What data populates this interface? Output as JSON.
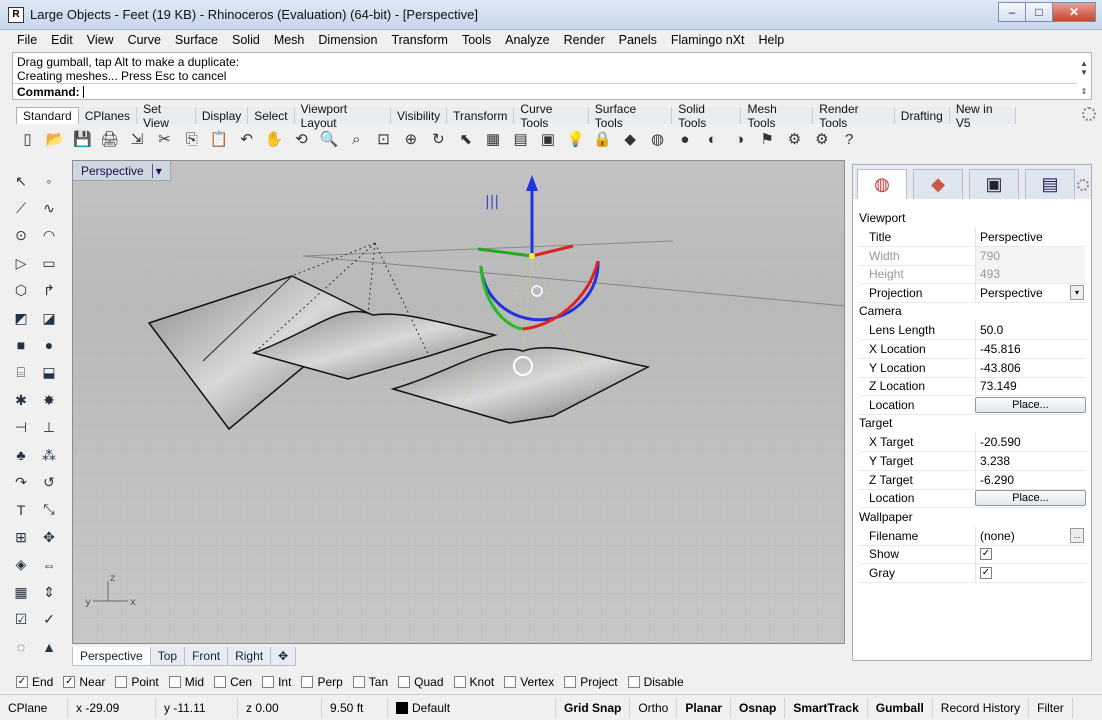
{
  "window": {
    "title": "Large Objects - Feet (19 KB) - Rhinoceros (Evaluation) (64-bit) - [Perspective]",
    "icon_glyph": "R",
    "min": "–",
    "max": "□",
    "close": "✕"
  },
  "menu": [
    "File",
    "Edit",
    "View",
    "Curve",
    "Surface",
    "Solid",
    "Mesh",
    "Dimension",
    "Transform",
    "Tools",
    "Analyze",
    "Render",
    "Panels",
    "Flamingo nXt",
    "Help"
  ],
  "command": {
    "history1": "Drag gumball, tap Alt to make a duplicate:",
    "history2": "Creating meshes... Press Esc to cancel",
    "label": "Command:",
    "value": ""
  },
  "toolbar_tabs": [
    "Standard",
    "CPlanes",
    "Set View",
    "Display",
    "Select",
    "Viewport Layout",
    "Visibility",
    "Transform",
    "Curve Tools",
    "Surface Tools",
    "Solid Tools",
    "Mesh Tools",
    "Render Tools",
    "Drafting",
    "New in V5"
  ],
  "toolbar_icons": [
    "new-icon",
    "open-icon",
    "save-icon",
    "print-icon",
    "import-icon",
    "cut-icon",
    "copy-icon",
    "paste-icon",
    "undo-icon",
    "pan-icon",
    "rotate-view-icon",
    "zoom-icon",
    "zoom-window-icon",
    "zoom-extents-icon",
    "zoom-selected-icon",
    "rotate-icon",
    "select-icon",
    "grid-icon",
    "layer-icon",
    "properties-icon",
    "light-icon",
    "lock-icon",
    "material-icon",
    "color-wheel-icon",
    "render-sphere-icon",
    "render-preview-icon",
    "shade-icon",
    "flag-icon",
    "options-icon",
    "options2-icon",
    "help-icon"
  ],
  "toolbar_glyphs": [
    "▯",
    "📂",
    "💾",
    "🖨",
    "⇲",
    "✂",
    "⎘",
    "📋",
    "↶",
    "✋",
    "⟲",
    "🔍",
    "⌕",
    "⊡",
    "⊕",
    "↻",
    "⬉",
    "▦",
    "▤",
    "▣",
    "💡",
    "🔒",
    "◆",
    "◍",
    "●",
    "◐",
    "◑",
    "⚑",
    "⚙",
    "⚙",
    "?"
  ],
  "left_icons": [
    {
      "name": "select-arrow-icon",
      "glyph": "↖"
    },
    {
      "name": "point-icon",
      "glyph": "◦"
    },
    {
      "name": "polyline-icon",
      "glyph": "⟋"
    },
    {
      "name": "curve-icon",
      "glyph": "∿"
    },
    {
      "name": "circle-icon",
      "glyph": "⊙"
    },
    {
      "name": "arc-icon",
      "glyph": "◠"
    },
    {
      "name": "triangle-icon",
      "glyph": "▷"
    },
    {
      "name": "rectangle-icon",
      "glyph": "▭"
    },
    {
      "name": "polygon-icon",
      "glyph": "⬡"
    },
    {
      "name": "fillet-icon",
      "glyph": "↱"
    },
    {
      "name": "surface-icon",
      "glyph": "◩"
    },
    {
      "name": "loft-icon",
      "glyph": "◪"
    },
    {
      "name": "box-icon",
      "glyph": "■"
    },
    {
      "name": "sphere-icon",
      "glyph": "●"
    },
    {
      "name": "cylinder-icon",
      "glyph": "⌸"
    },
    {
      "name": "extrude-icon",
      "glyph": "⬓"
    },
    {
      "name": "boolean-icon",
      "glyph": "✱"
    },
    {
      "name": "explode-icon",
      "glyph": "✸"
    },
    {
      "name": "trim-icon",
      "glyph": "⊣"
    },
    {
      "name": "split-icon",
      "glyph": "⊥"
    },
    {
      "name": "group-icon",
      "glyph": "♣"
    },
    {
      "name": "array-icon",
      "glyph": "⁂"
    },
    {
      "name": "move-icon",
      "glyph": "↷"
    },
    {
      "name": "copy-tool-icon",
      "glyph": "↺"
    },
    {
      "name": "text-icon",
      "glyph": "T"
    },
    {
      "name": "scale-icon",
      "glyph": "⤡"
    },
    {
      "name": "gumball-icon",
      "glyph": "⊞"
    },
    {
      "name": "drag-icon",
      "glyph": "✥"
    },
    {
      "name": "analyze-icon",
      "glyph": "◈"
    },
    {
      "name": "dimension-icon",
      "glyph": "⇔"
    },
    {
      "name": "grid-array-icon",
      "glyph": "▦"
    },
    {
      "name": "nudge-icon",
      "glyph": "⇕"
    },
    {
      "name": "check-icon",
      "glyph": "☑"
    },
    {
      "name": "checkmark-icon",
      "glyph": "✓"
    },
    {
      "name": "hide-icon",
      "glyph": "◌"
    },
    {
      "name": "warning-icon",
      "glyph": "▲"
    }
  ],
  "viewport": {
    "title": "Perspective",
    "dropdown": "▾",
    "axis_x": "x",
    "axis_y": "y",
    "axis_z": "z",
    "gumball_glyph": "|||"
  },
  "viewport_tabs": [
    "Perspective",
    "Top",
    "Front",
    "Right",
    "✥"
  ],
  "osnaps": [
    {
      "label": "End",
      "checked": true
    },
    {
      "label": "Near",
      "checked": true
    },
    {
      "label": "Point",
      "checked": false
    },
    {
      "label": "Mid",
      "checked": false
    },
    {
      "label": "Cen",
      "checked": false
    },
    {
      "label": "Int",
      "checked": false
    },
    {
      "label": "Perp",
      "checked": false
    },
    {
      "label": "Tan",
      "checked": false
    },
    {
      "label": "Quad",
      "checked": false
    },
    {
      "label": "Knot",
      "checked": false
    },
    {
      "label": "Vertex",
      "checked": false
    },
    {
      "label": "Project",
      "checked": false
    },
    {
      "label": "Disable",
      "checked": false
    }
  ],
  "status": {
    "cplane": "CPlane",
    "x": "x -29.09",
    "y": "y -11.11",
    "z": "z 0.00",
    "units": "9.50 ft",
    "layer": "Default",
    "toggles": [
      "Grid Snap",
      "Ortho",
      "Planar",
      "Osnap",
      "SmartTrack",
      "Gumball",
      "Record History",
      "Filter"
    ],
    "bold": [
      true,
      false,
      true,
      true,
      true,
      true,
      false,
      false
    ]
  },
  "panel": {
    "tab_glyphs": [
      "◍",
      "◆",
      "▣",
      "▤"
    ],
    "viewport_section": "Viewport",
    "rows1": [
      [
        "Title",
        "Perspective"
      ],
      [
        "Width",
        "790"
      ],
      [
        "Height",
        "493"
      ],
      [
        "Projection",
        "Perspective"
      ]
    ],
    "camera_section": "Camera",
    "rows2": [
      [
        "Lens Length",
        "50.0"
      ],
      [
        "X Location",
        "-45.816"
      ],
      [
        "Y Location",
        "-43.806"
      ],
      [
        "Z Location",
        "73.149"
      ],
      [
        "Location",
        "Place..."
      ]
    ],
    "target_section": "Target",
    "rows3": [
      [
        "X Target",
        "-20.590"
      ],
      [
        "Y Target",
        "3.238"
      ],
      [
        "Z Target",
        "-6.290"
      ],
      [
        "Location",
        "Place..."
      ]
    ],
    "wallpaper_section": "Wallpaper",
    "rows4": [
      [
        "Filename",
        "(none)"
      ],
      [
        "Show",
        "✓"
      ],
      [
        "Gray",
        "✓"
      ]
    ],
    "browse": "...",
    "dropdown": "▾"
  }
}
